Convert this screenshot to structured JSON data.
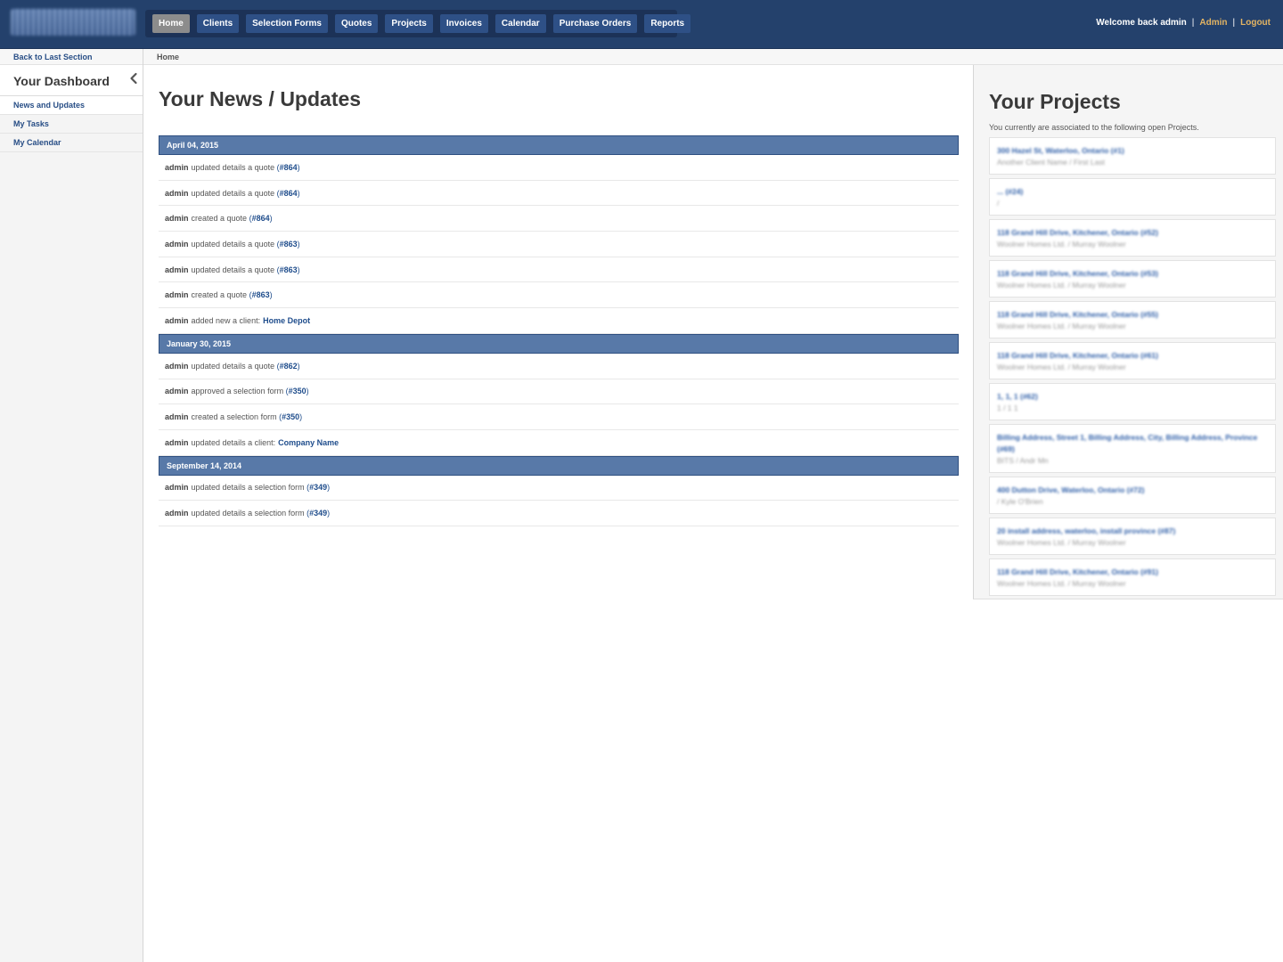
{
  "header": {
    "nav": [
      {
        "label": "Home",
        "active": true
      },
      {
        "label": "Clients"
      },
      {
        "label": "Selection Forms"
      },
      {
        "label": "Quotes"
      },
      {
        "label": "Projects"
      },
      {
        "label": "Invoices"
      },
      {
        "label": "Calendar"
      },
      {
        "label": "Purchase Orders"
      },
      {
        "label": "Reports"
      }
    ],
    "welcome": "Welcome back admin",
    "admin_link": "Admin",
    "logout_link": "Logout",
    "separator": "|"
  },
  "sidebar": {
    "back_link": "Back to Last Section",
    "title": "Your Dashboard",
    "items": [
      {
        "label": "News and Updates"
      },
      {
        "label": "My Tasks"
      },
      {
        "label": "My Calendar"
      }
    ]
  },
  "breadcrumb": "Home",
  "main": {
    "title": "Your News / Updates",
    "groups": [
      {
        "date": "April 04, 2015",
        "items": [
          {
            "actor": "admin",
            "action": "updated details a quote",
            "ref": "#864"
          },
          {
            "actor": "admin",
            "action": "updated details a quote",
            "ref": "#864"
          },
          {
            "actor": "admin",
            "action": "created a quote",
            "ref": "#864"
          },
          {
            "actor": "admin",
            "action": "updated details a quote",
            "ref": "#863"
          },
          {
            "actor": "admin",
            "action": "updated details a quote",
            "ref": "#863"
          },
          {
            "actor": "admin",
            "action": "created a quote",
            "ref": "#863"
          },
          {
            "actor": "admin",
            "action": "added new a client:",
            "client": "Home Depot"
          }
        ]
      },
      {
        "date": "January 30, 2015",
        "items": [
          {
            "actor": "admin",
            "action": "updated details a quote",
            "ref": "#862"
          },
          {
            "actor": "admin",
            "action": "approved a selection form",
            "ref": "#350"
          },
          {
            "actor": "admin",
            "action": "created a selection form",
            "ref": "#350"
          },
          {
            "actor": "admin",
            "action": "updated details a client:",
            "client": "Company Name"
          }
        ]
      },
      {
        "date": "September 14, 2014",
        "items": [
          {
            "actor": "admin",
            "action": "updated details a selection form",
            "ref": "#349"
          },
          {
            "actor": "admin",
            "action": "updated details a selection form",
            "ref": "#349"
          }
        ]
      }
    ]
  },
  "projects": {
    "title": "Your Projects",
    "subtitle": "You currently are associated to the following open Projects.",
    "items": [
      {
        "name": "300 Hazel St, Waterloo, Ontario (#1)",
        "client": "Another Client Name / First Last"
      },
      {
        "name": "... (#24)",
        "client": "/"
      },
      {
        "name": "118 Grand Hill Drive, Kitchener, Ontario (#52)",
        "client": "Woolner Homes Ltd. / Murray Woolner"
      },
      {
        "name": "118 Grand Hill Drive, Kitchener, Ontario (#53)",
        "client": "Woolner Homes Ltd. / Murray Woolner"
      },
      {
        "name": "118 Grand Hill Drive, Kitchener, Ontario (#55)",
        "client": "Woolner Homes Ltd. / Murray Woolner"
      },
      {
        "name": "118 Grand Hill Drive, Kitchener, Ontario (#61)",
        "client": "Woolner Homes Ltd. / Murray Woolner"
      },
      {
        "name": "1, 1, 1 (#62)",
        "client": "1 / 1 1"
      },
      {
        "name": "Billing Address, Street 1, Billing Address, City, Billing Address, Province (#69)",
        "client": "BITS / Andr Mn"
      },
      {
        "name": "400 Dutton Drive, Waterloo, Ontario (#72)",
        "client": "/ Kyle O'Brien"
      },
      {
        "name": "20 install address, waterloo, install province (#87)",
        "client": "Woolner Homes Ltd. / Murray Woolner"
      },
      {
        "name": "118 Grand Hill Drive, Kitchener, Ontario (#91)",
        "client": "Woolner Homes Ltd. / Murray Woolner"
      }
    ]
  }
}
